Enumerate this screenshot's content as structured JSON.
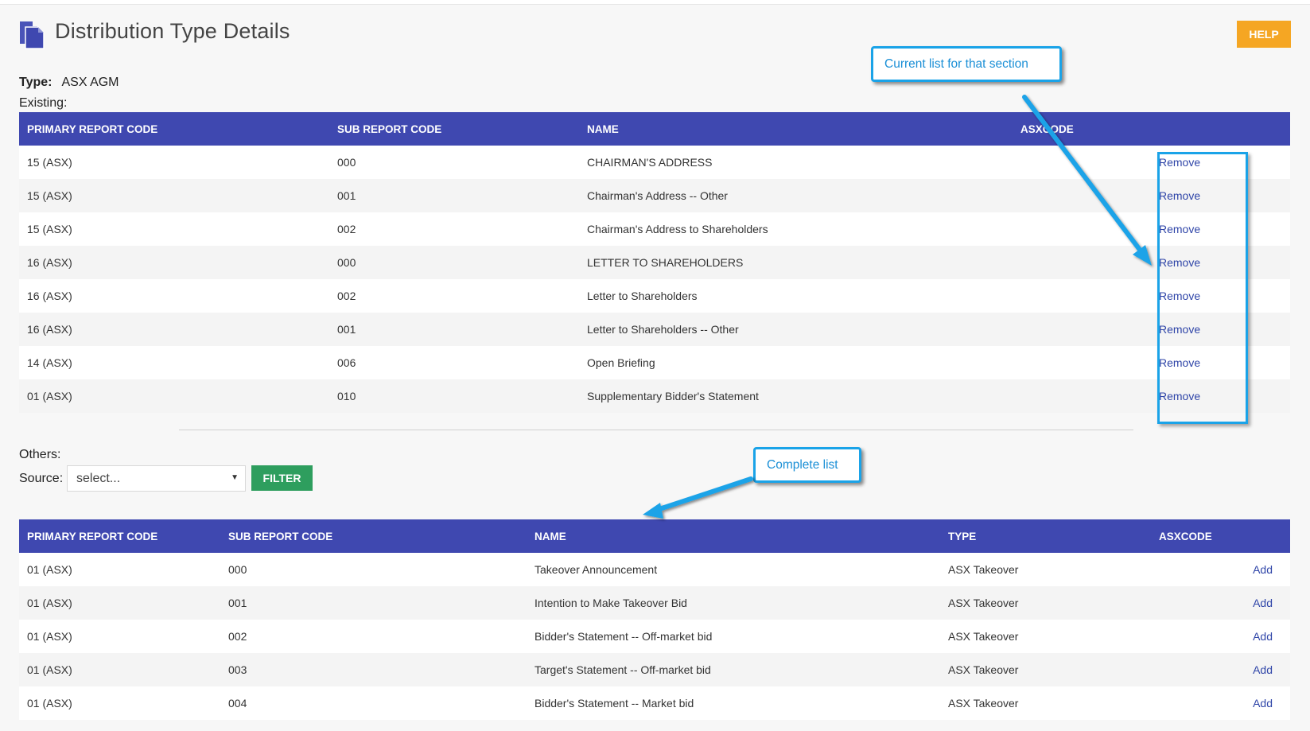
{
  "page": {
    "title": "Distribution Type Details",
    "help_label": "HELP",
    "type_label": "Type:",
    "type_value": "ASX AGM",
    "existing_label": "Existing:",
    "others_label": "Others:",
    "source_label": "Source:",
    "source_selected": "select...",
    "filter_label": "FILTER"
  },
  "existing_table": {
    "headers": [
      "PRIMARY REPORT CODE",
      "SUB REPORT CODE",
      "NAME",
      "ASXCODE"
    ],
    "action_label": "Remove",
    "rows": [
      {
        "primary": "15 (ASX)",
        "sub": "000",
        "name": "CHAIRMAN'S ADDRESS",
        "asxcode": ""
      },
      {
        "primary": "15 (ASX)",
        "sub": "001",
        "name": "Chairman's Address -- Other",
        "asxcode": ""
      },
      {
        "primary": "15 (ASX)",
        "sub": "002",
        "name": "Chairman's Address to Shareholders",
        "asxcode": ""
      },
      {
        "primary": "16 (ASX)",
        "sub": "000",
        "name": "LETTER TO SHAREHOLDERS",
        "asxcode": ""
      },
      {
        "primary": "16 (ASX)",
        "sub": "002",
        "name": "Letter to Shareholders",
        "asxcode": ""
      },
      {
        "primary": "16 (ASX)",
        "sub": "001",
        "name": "Letter to Shareholders -- Other",
        "asxcode": ""
      },
      {
        "primary": "14 (ASX)",
        "sub": "006",
        "name": "Open Briefing",
        "asxcode": ""
      },
      {
        "primary": "01 (ASX)",
        "sub": "010",
        "name": "Supplementary Bidder's Statement",
        "asxcode": ""
      }
    ]
  },
  "others_table": {
    "headers": [
      "PRIMARY REPORT CODE",
      "SUB REPORT CODE",
      "NAME",
      "TYPE",
      "ASXCODE"
    ],
    "action_label": "Add",
    "rows": [
      {
        "primary": "01 (ASX)",
        "sub": "000",
        "name": "Takeover Announcement",
        "type": "ASX Takeover",
        "asxcode": ""
      },
      {
        "primary": "01 (ASX)",
        "sub": "001",
        "name": "Intention to Make Takeover Bid",
        "type": "ASX Takeover",
        "asxcode": ""
      },
      {
        "primary": "01 (ASX)",
        "sub": "002",
        "name": "Bidder's Statement -- Off-market bid",
        "type": "ASX Takeover",
        "asxcode": ""
      },
      {
        "primary": "01 (ASX)",
        "sub": "003",
        "name": "Target's Statement -- Off-market bid",
        "type": "ASX Takeover",
        "asxcode": ""
      },
      {
        "primary": "01 (ASX)",
        "sub": "004",
        "name": "Bidder's Statement -- Market bid",
        "type": "ASX Takeover",
        "asxcode": ""
      }
    ]
  },
  "annotations": {
    "callout_current": "Current list for that section",
    "callout_complete": "Complete list"
  },
  "colors": {
    "header_bar": "#3f48b0",
    "help_button": "#f5a623",
    "filter_button": "#2e9e5e",
    "link": "#2f45a8",
    "annotation": "#1aa3e8"
  },
  "icons": {
    "title_icon": "documents-icon",
    "select_caret": "caret-down-icon"
  }
}
